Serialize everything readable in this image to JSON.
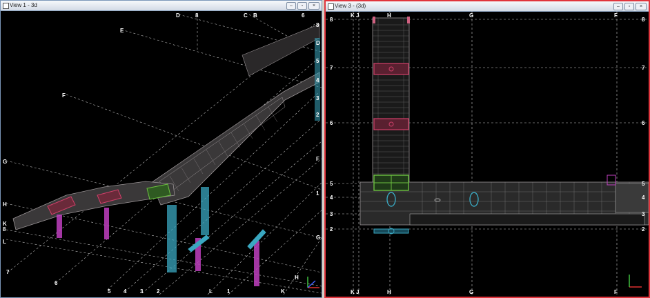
{
  "window1": {
    "title": "View 1 - 3d",
    "buttons": {
      "minimize": "–",
      "restore": "▫",
      "close": "×"
    },
    "grid_labels": {
      "D": "D",
      "E": "E",
      "F": "F",
      "G": "G",
      "H": "H",
      "K": "K",
      "L": "L",
      "C": "C",
      "B": "B",
      "top8": "8",
      "top6": "6",
      "r8": "8",
      "rD": "D",
      "r5": "5",
      "r4": "4",
      "r3": "3",
      "r2": "2",
      "rF": "F",
      "r1": "1",
      "rG": "G",
      "l8": "8",
      "l7": "7",
      "l6": "6",
      "b5": "5",
      "b4": "4",
      "b3": "3",
      "b2": "2",
      "bL": "L",
      "b1": "1",
      "bK": "K",
      "bH": "H"
    }
  },
  "window2": {
    "title": "View 3 - (3d)",
    "buttons": {
      "minimize": "–",
      "restore": "▫",
      "close": "×"
    },
    "columns_top": [
      "K",
      "J",
      "H",
      "G",
      "F"
    ],
    "columns_bottom": [
      "K",
      "J",
      "H",
      "G",
      "F"
    ],
    "rows_left": [
      "8",
      "7",
      "6",
      "5",
      "4",
      "3",
      "2"
    ],
    "rows_right": [
      "8",
      "7",
      "6",
      "5",
      "4",
      "3",
      "2"
    ]
  },
  "colors": {
    "structure": "#9a9496",
    "highlight_red": "#d0406a",
    "highlight_green": "#6cc040",
    "column_cyan": "#3aa7c0",
    "column_magenta": "#c040c0",
    "active_border": "#e0343c"
  }
}
